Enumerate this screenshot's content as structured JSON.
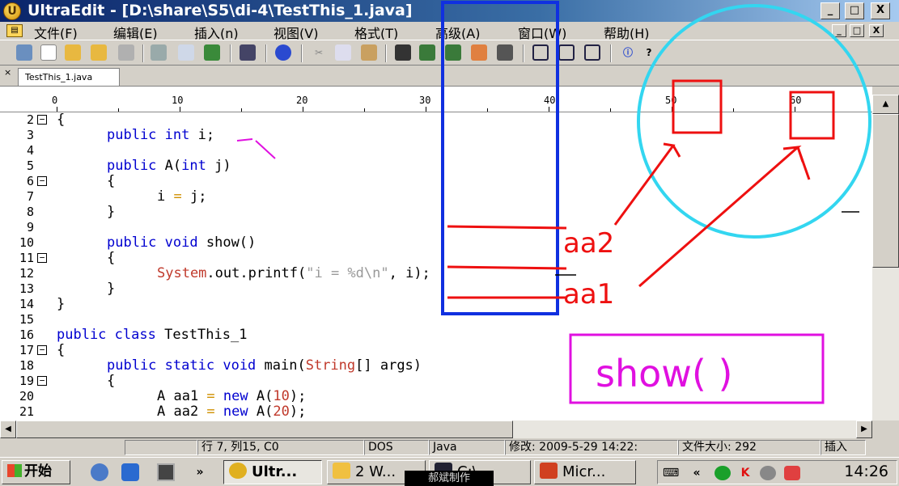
{
  "window": {
    "title": "UltraEdit - [D:\\share\\S5\\di-4\\TestThis_1.java]",
    "minimize": "_",
    "maximize": "□",
    "close": "X"
  },
  "menu": [
    "文件(F)",
    "编辑(E)",
    "插入(n)",
    "视图(V)",
    "格式(T)",
    "高级(A)",
    "窗口(W)",
    "帮助(H)"
  ],
  "tab": {
    "label": "TestThis_1.java",
    "close": "×"
  },
  "ruler": [
    "0",
    "10",
    "20",
    "30",
    "40",
    "50",
    "60"
  ],
  "code_lines": [
    {
      "n": "2",
      "fold": "−",
      "text": "{"
    },
    {
      "n": "3",
      "fold": "",
      "text": "public int i;"
    },
    {
      "n": "4",
      "fold": "",
      "text": ""
    },
    {
      "n": "5",
      "fold": "",
      "text": "public A(int j)"
    },
    {
      "n": "6",
      "fold": "−",
      "text": "{"
    },
    {
      "n": "7",
      "fold": "",
      "text": "i = j;"
    },
    {
      "n": "8",
      "fold": "",
      "text": "}"
    },
    {
      "n": "9",
      "fold": "",
      "text": ""
    },
    {
      "n": "10",
      "fold": "",
      "text": "public void show()"
    },
    {
      "n": "11",
      "fold": "−",
      "text": "{"
    },
    {
      "n": "12",
      "fold": "",
      "text": "System.out.printf(\"i = %d\\n\", i);"
    },
    {
      "n": "13",
      "fold": "",
      "text": "}"
    },
    {
      "n": "14",
      "fold": "",
      "text": "}"
    },
    {
      "n": "15",
      "fold": "",
      "text": ""
    },
    {
      "n": "16",
      "fold": "",
      "text": "public class TestThis_1"
    },
    {
      "n": "17",
      "fold": "−",
      "text": "{"
    },
    {
      "n": "18",
      "fold": "",
      "text": "public static void main(String[] args)"
    },
    {
      "n": "19",
      "fold": "−",
      "text": "{"
    },
    {
      "n": "20",
      "fold": "",
      "text": "A aa1 = new A(10);"
    },
    {
      "n": "21",
      "fold": "",
      "text": "A aa2 = new A(20);"
    }
  ],
  "status": {
    "position": "行 7, 列15, C0",
    "format": "DOS",
    "language": "Java",
    "modified": "修改:  2009-5-29 14:22:",
    "filesize": "文件大小:  292",
    "mode": "插入"
  },
  "taskbar": {
    "start": "开始",
    "more": "»",
    "tasks": [
      "Ultr...",
      "2 W...",
      "C:\\...",
      "Micr..."
    ],
    "tray_more": "«",
    "clock": "14:26",
    "watermark": "郝斌制作"
  },
  "annotations": {
    "aa2_label": "aa2",
    "aa1_label": "aa1",
    "method_label": "show( )",
    "colors": {
      "blue": "#1030e0",
      "red": "#ee1010",
      "cyan": "#33d6f0",
      "magenta": "#e010e0"
    }
  }
}
